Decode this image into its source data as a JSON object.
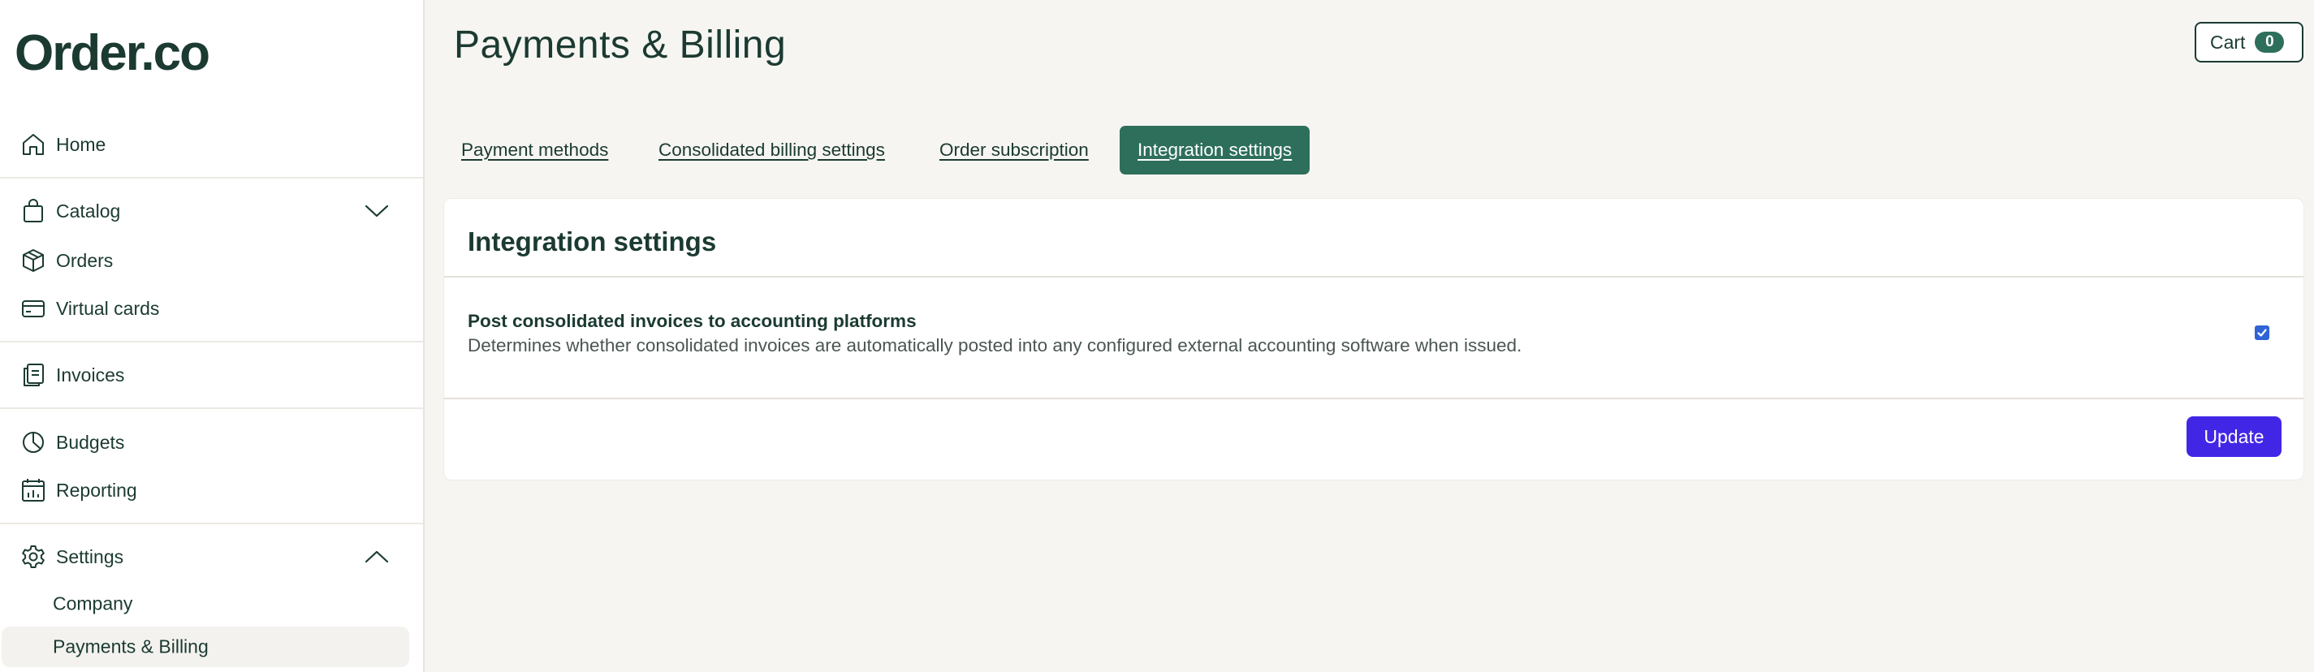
{
  "brand": {
    "logo": "Order.co"
  },
  "sidebar": {
    "items": [
      {
        "label": "Home",
        "icon": "home-icon"
      },
      {
        "label": "Catalog",
        "icon": "shopping-bag-icon",
        "chevron": "chevron-down-icon"
      },
      {
        "label": "Orders",
        "icon": "package-icon"
      },
      {
        "label": "Virtual cards",
        "icon": "credit-card-icon"
      },
      {
        "label": "Invoices",
        "icon": "invoice-icon"
      },
      {
        "label": "Budgets",
        "icon": "pie-chart-icon"
      },
      {
        "label": "Reporting",
        "icon": "calendar-report-icon"
      },
      {
        "label": "Settings",
        "icon": "gear-icon",
        "chevron": "chevron-up-icon"
      }
    ],
    "settings_sub": [
      {
        "label": "Company"
      },
      {
        "label": "Payments & Billing",
        "active": true
      }
    ]
  },
  "header": {
    "title": "Payments & Billing",
    "cart_label": "Cart",
    "cart_count": "0"
  },
  "tabs": [
    {
      "label": "Payment methods"
    },
    {
      "label": "Consolidated billing settings"
    },
    {
      "label": "Order subscription"
    },
    {
      "label": "Integration settings",
      "active": true
    }
  ],
  "card": {
    "title": "Integration settings",
    "setting": {
      "name": "Post consolidated invoices to accounting platforms",
      "description": "Determines whether consolidated invoices are automatically posted into any configured external accounting software when issued.",
      "checked": true
    },
    "update_label": "Update"
  },
  "colors": {
    "brand_green": "#1b3a32",
    "active_tab": "#2e6f5c",
    "update_button": "#4226e6",
    "checkbox": "#2f63d6",
    "page_background": "#f6f5f1"
  }
}
